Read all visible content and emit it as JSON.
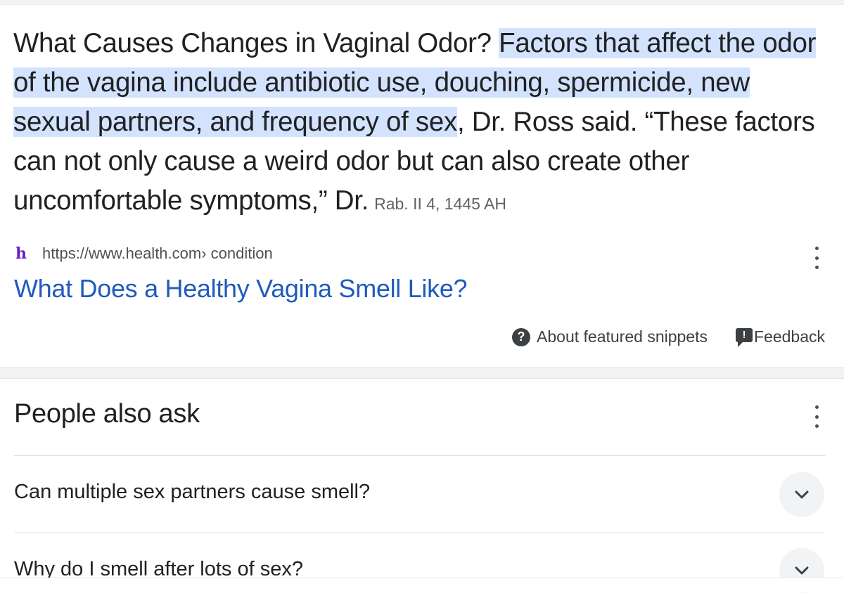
{
  "snippet": {
    "lead": "What Causes Changes in Vaginal Odor? ",
    "highlight": "Factors that affect the odor of the vagina include antibiotic use, douching, spermicide, new sexual partners, and frequency of sex",
    "tail": ", Dr. Ross said. “These factors can not only cause a weird odor but can also create other uncomfortable symptoms,” Dr.",
    "date": "Rab. II 4, 1445 AH"
  },
  "source": {
    "favicon_letter": "h",
    "url": "https://www.health.com",
    "path": " › condition",
    "title": "What Does a Healthy Vagina Smell Like?"
  },
  "snippet_footer": {
    "about_label": "About featured snippets",
    "feedback_label": "Feedback",
    "about_icon": "question-circle-icon",
    "feedback_icon": "feedback-flag-icon"
  },
  "people_also_ask": {
    "title": "People also ask",
    "questions": [
      "Can multiple sex partners cause smell?",
      "Why do I smell after lots of sex?"
    ]
  },
  "colors": {
    "highlight": "#d3e3fd",
    "link": "#1f5bbd",
    "favicon": "#6a1bc4"
  }
}
